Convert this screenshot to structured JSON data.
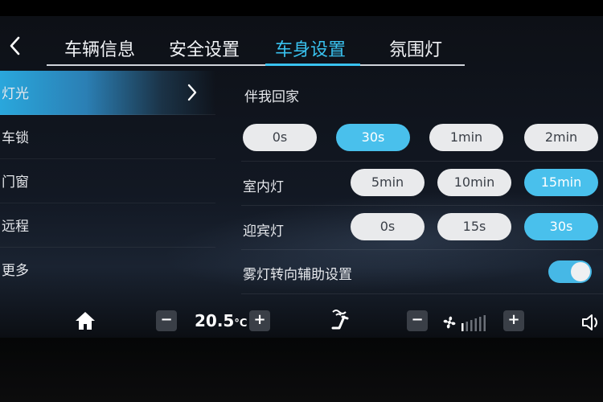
{
  "header": {
    "tabs": [
      {
        "label": "车辆信息"
      },
      {
        "label": "安全设置"
      },
      {
        "label": "车身设置",
        "active": true
      },
      {
        "label": "氛围灯"
      }
    ]
  },
  "sidebar": {
    "items": [
      {
        "label": "灯光",
        "active": true
      },
      {
        "label": "车锁"
      },
      {
        "label": "门窗"
      },
      {
        "label": "远程"
      },
      {
        "label": "更多"
      }
    ]
  },
  "settings": {
    "follow_me_home": {
      "label": "伴我回家",
      "options": [
        "0s",
        "30s",
        "1min",
        "2min"
      ],
      "selected": "30s"
    },
    "interior_light": {
      "label": "室内灯",
      "options": [
        "5min",
        "10min",
        "15min"
      ],
      "selected": "15min"
    },
    "welcome_light": {
      "label": "迎宾灯",
      "options": [
        "0s",
        "15s",
        "30s"
      ],
      "selected": "30s"
    },
    "fog_light_assist": {
      "label": "雾灯转向辅助设置",
      "enabled": true
    }
  },
  "bottom_bar": {
    "temp_minus": "−",
    "temp_value": "20.5",
    "temp_unit": "°C",
    "temp_plus": "+",
    "fan_minus": "−",
    "fan_plus": "+",
    "fan_level": 1,
    "fan_levels_total": 6
  },
  "colors": {
    "accent": "#39c2ef",
    "pill_selected": "#49c0ec",
    "pill_unselected": "#e9eaec"
  }
}
